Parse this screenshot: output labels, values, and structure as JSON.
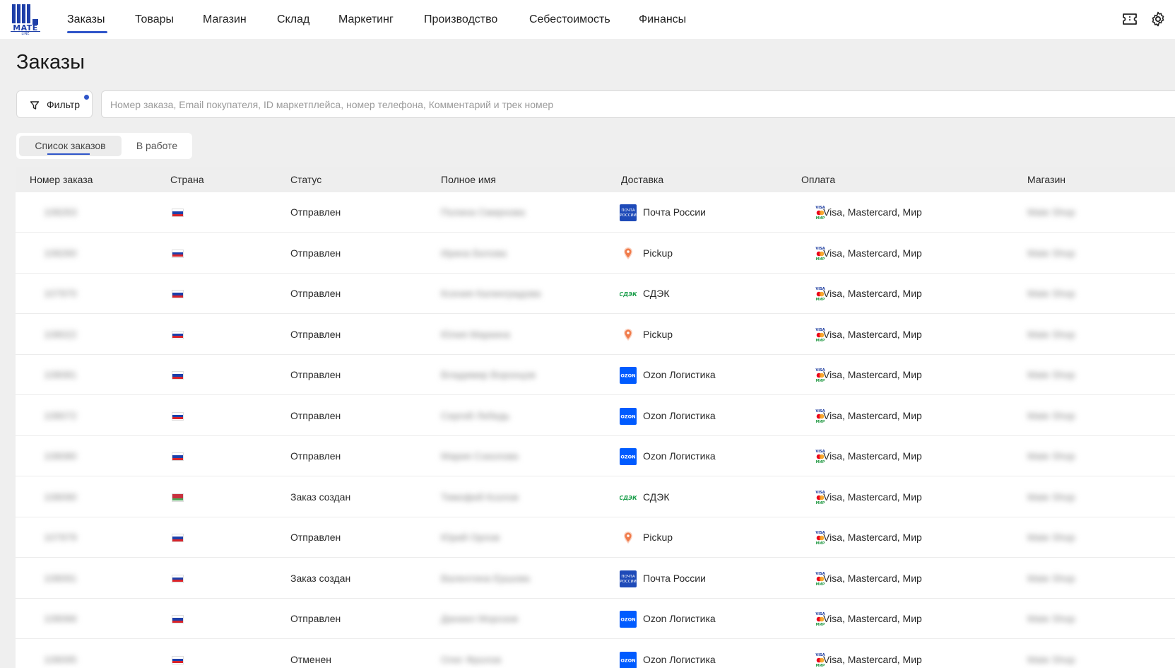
{
  "app": {
    "logo_text": "MATE",
    "logo_sub": "LINE"
  },
  "nav": {
    "items": [
      "Заказы",
      "Товары",
      "Магазин",
      "Склад",
      "Маркетинг",
      "Производство",
      "Себестоимость",
      "Финансы"
    ],
    "active": "Заказы",
    "right_icons": [
      "ticket-icon",
      "gear-icon"
    ]
  },
  "page": {
    "title": "Заказы"
  },
  "toolbar": {
    "filter_label": "Фильтр",
    "search_placeholder": "Номер заказа, Email покупателя, ID маркетплейса, номер телефона, Комментарий и трек номер"
  },
  "tabs": {
    "items": [
      "Список заказов",
      "В работе"
    ],
    "active": "Список заказов"
  },
  "table": {
    "columns": [
      "Номер заказа",
      "Страна",
      "Статус",
      "Полное имя",
      "Доставка",
      "Оплата",
      "Магазин"
    ],
    "rows": [
      {
        "order": "108263",
        "flag": "ru",
        "status": "Отправлен",
        "name": "Полина Смирнова",
        "delivery": "Почта России",
        "delivery_icon": "pochta",
        "payment": "Visa, Mastercard, Мир",
        "shop": "Mate Shop"
      },
      {
        "order": "108260",
        "flag": "ru",
        "status": "Отправлен",
        "name": "Ирина Белова",
        "delivery": "Pickup",
        "delivery_icon": "pickup",
        "payment": "Visa, Mastercard, Мир",
        "shop": "Mate Shop"
      },
      {
        "order": "107970",
        "flag": "ru",
        "status": "Отправлен",
        "name": "Ксения Калинградова",
        "delivery": "СДЭК",
        "delivery_icon": "cdek",
        "payment": "Visa, Mastercard, Мир",
        "shop": "Mate Shop"
      },
      {
        "order": "108022",
        "flag": "ru",
        "status": "Отправлен",
        "name": "Юлия Маркина",
        "delivery": "Pickup",
        "delivery_icon": "pickup",
        "payment": "Visa, Mastercard, Мир",
        "shop": "Mate Shop"
      },
      {
        "order": "108081",
        "flag": "ru",
        "status": "Отправлен",
        "name": "Владимир Воронцов",
        "delivery": "Ozon Логистика",
        "delivery_icon": "ozon",
        "payment": "Visa, Mastercard, Мир",
        "shop": "Mate Shop"
      },
      {
        "order": "108072",
        "flag": "ru",
        "status": "Отправлен",
        "name": "Сергей Лебедь",
        "delivery": "Ozon Логистика",
        "delivery_icon": "ozon",
        "payment": "Visa, Mastercard, Мир",
        "shop": "Mate Shop"
      },
      {
        "order": "108080",
        "flag": "ru",
        "status": "Отправлен",
        "name": "Мария Соколова",
        "delivery": "Ozon Логистика",
        "delivery_icon": "ozon",
        "payment": "Visa, Mastercard, Мир",
        "shop": "Mate Shop"
      },
      {
        "order": "108090",
        "flag": "by",
        "status": "Заказ создан",
        "name": "Тимофей Козлов",
        "delivery": "СДЭК",
        "delivery_icon": "cdek",
        "payment": "Visa, Mastercard, Мир",
        "shop": "Mate Shop"
      },
      {
        "order": "107979",
        "flag": "ru",
        "status": "Отправлен",
        "name": "Юрий Орлов",
        "delivery": "Pickup",
        "delivery_icon": "pickup",
        "payment": "Visa, Mastercard, Мир",
        "shop": "Mate Shop"
      },
      {
        "order": "108091",
        "flag": "ru",
        "status": "Заказ создан",
        "name": "Валентина Ершова",
        "delivery": "Почта России",
        "delivery_icon": "pochta",
        "payment": "Visa, Mastercard, Мир",
        "shop": "Mate Shop"
      },
      {
        "order": "108066",
        "flag": "ru",
        "status": "Отправлен",
        "name": "Даниил Морозов",
        "delivery": "Ozon Логистика",
        "delivery_icon": "ozon",
        "payment": "Visa, Mastercard, Мир",
        "shop": "Mate Shop"
      },
      {
        "order": "108095",
        "flag": "ru",
        "status": "Отменен",
        "name": "Олег Фролов",
        "delivery": "Ozon Логистика",
        "delivery_icon": "ozon",
        "payment": "Visa, Mastercard, Мир",
        "shop": "Mate Shop"
      }
    ]
  },
  "colors": {
    "accent": "#2f55c9",
    "brand": "#1e3fa8",
    "background": "#efefef",
    "cdek_green": "#1a9e4a",
    "ozon_blue": "#005bff",
    "pickup_orange": "#f07b4a"
  }
}
